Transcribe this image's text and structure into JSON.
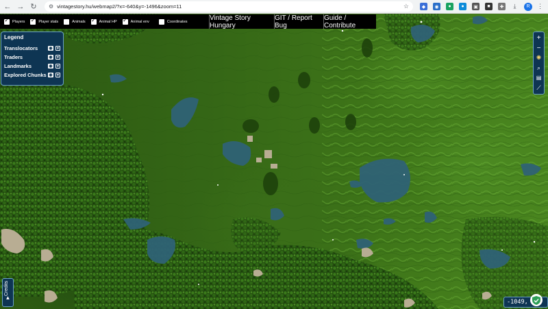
{
  "browser": {
    "url": "vintagestory.hu/webmap2/?x=-640&y=-1496&zoom=11",
    "back_icon": "arrow-left-icon",
    "forward_icon": "arrow-right-icon",
    "reload_icon": "reload-icon",
    "bookmark_icon": "star-icon"
  },
  "toggles": [
    {
      "label": "Players",
      "checked": true
    },
    {
      "label": "Player stats",
      "checked": true
    },
    {
      "label": "Animals",
      "checked": false
    },
    {
      "label": "Animal HP",
      "checked": true
    },
    {
      "label": "Animal env",
      "checked": true
    },
    {
      "label": "Coordinates",
      "checked": false
    }
  ],
  "top_buttons": {
    "hungary": "Vintage Story Hungary",
    "git": "GIT / Report Bug",
    "guide": "Guide / Contribute"
  },
  "legend": {
    "title": "Legend",
    "items": [
      {
        "label": "Translocators"
      },
      {
        "label": "Traders"
      },
      {
        "label": "Landmarks"
      },
      {
        "label": "Explored Chunks"
      }
    ]
  },
  "controls": {
    "zoom_in": "+",
    "zoom_out": "−"
  },
  "credits": {
    "label": "Credits"
  },
  "coordinates": {
    "text": "-1049, 1"
  },
  "colors": {
    "panel": "#0e3553",
    "panel_border": "#6aa0c8",
    "water": "#2d5f6e",
    "forest": "#1f4a0e",
    "grass": "#3f7619"
  }
}
